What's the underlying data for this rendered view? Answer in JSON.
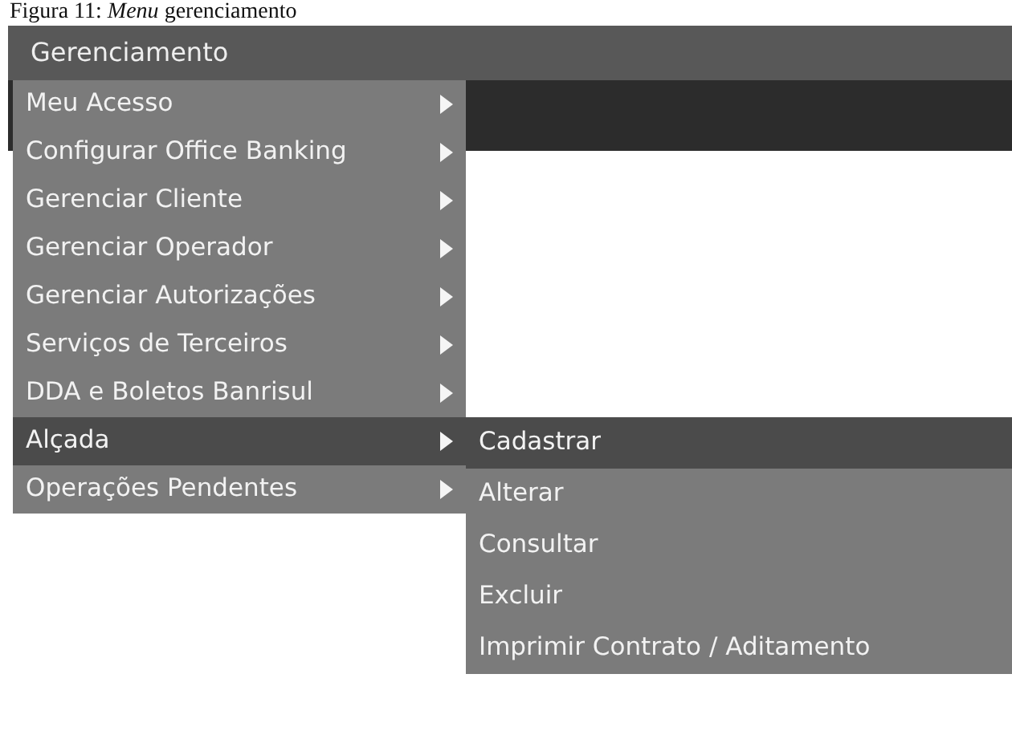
{
  "caption": "Figura 11: *Menu* gerenciamento",
  "menu": {
    "title": "Gerenciamento",
    "items": [
      {
        "label": "Meu Acesso",
        "selected": false,
        "has_submenu": true
      },
      {
        "label": "Configurar Office Banking",
        "selected": false,
        "has_submenu": true
      },
      {
        "label": "Gerenciar Cliente",
        "selected": false,
        "has_submenu": true
      },
      {
        "label": "Gerenciar Operador",
        "selected": false,
        "has_submenu": true
      },
      {
        "label": "Gerenciar Autorizações",
        "selected": false,
        "has_submenu": true
      },
      {
        "label": "Serviços de Terceiros",
        "selected": false,
        "has_submenu": true
      },
      {
        "label": "DDA e Boletos Banrisul",
        "selected": false,
        "has_submenu": true
      },
      {
        "label": "Alçada",
        "selected": true,
        "has_submenu": true
      },
      {
        "label": "Operações Pendentes",
        "selected": false,
        "has_submenu": true
      }
    ]
  },
  "submenu": {
    "items": [
      {
        "label": "Cadastrar",
        "selected": true
      },
      {
        "label": "Alterar",
        "selected": false
      },
      {
        "label": "Consultar",
        "selected": false
      },
      {
        "label": "Excluir",
        "selected": false
      },
      {
        "label": "Imprimir Contrato / Aditamento",
        "selected": false
      }
    ]
  }
}
